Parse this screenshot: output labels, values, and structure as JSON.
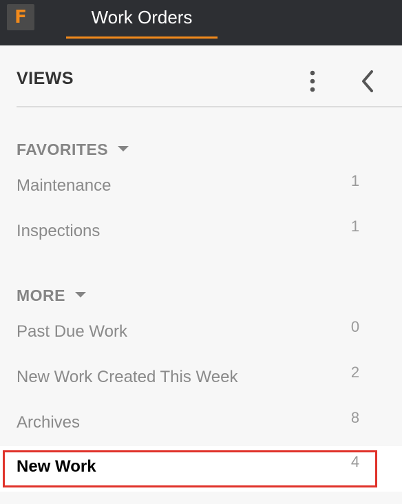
{
  "app": {
    "logo_letter": "F",
    "nav_tab": "Work Orders"
  },
  "views": {
    "title": "VIEWS",
    "menu_icon": "kebab-menu-icon",
    "collapse_icon": "chevron-left-icon"
  },
  "favorites": {
    "heading": "FAVORITES",
    "items": [
      {
        "label": "Maintenance",
        "count": "1"
      },
      {
        "label": "Inspections",
        "count": "1"
      }
    ]
  },
  "more": {
    "heading": "MORE",
    "items": [
      {
        "label": "Past Due Work",
        "count": "0"
      },
      {
        "label": "New Work Created This Week",
        "count": "2"
      },
      {
        "label": "Archives",
        "count": "8"
      },
      {
        "label": "New Work",
        "count": "4"
      }
    ]
  },
  "colors": {
    "accent": "#f28a1b",
    "topbar": "#2d2f33",
    "highlight": "#e0322a"
  }
}
